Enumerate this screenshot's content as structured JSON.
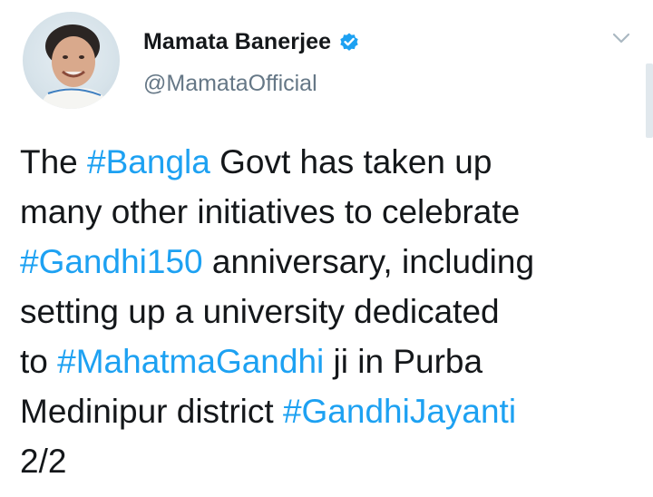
{
  "author": {
    "name": "Mamata Banerjee",
    "handle": "@MamataOfficial",
    "verified": true,
    "avatar_icon": "profile-photo-icon"
  },
  "colors": {
    "hashtag": "#1da1f2",
    "text": "#14171a",
    "secondary": "#657786",
    "verified_badge": "#1da1f2"
  },
  "tweet": {
    "lines": [
      [
        {
          "t": "The "
        },
        {
          "t": "#Bangla",
          "tag": true
        },
        {
          "t": " Govt has taken up"
        }
      ],
      [
        {
          "t": "many other initiatives to celebrate"
        }
      ],
      [
        {
          "t": "#Gandhi150",
          "tag": true
        },
        {
          "t": " anniversary, including"
        }
      ],
      [
        {
          "t": "setting up a university dedicated"
        }
      ],
      [
        {
          "t": "to "
        },
        {
          "t": "#MahatmaGandhi",
          "tag": true
        },
        {
          "t": " ji in Purba"
        }
      ],
      [
        {
          "t": "Medinipur district "
        },
        {
          "t": "#GandhiJayanti",
          "tag": true
        }
      ],
      [
        {
          "t": "2/2"
        }
      ]
    ]
  }
}
